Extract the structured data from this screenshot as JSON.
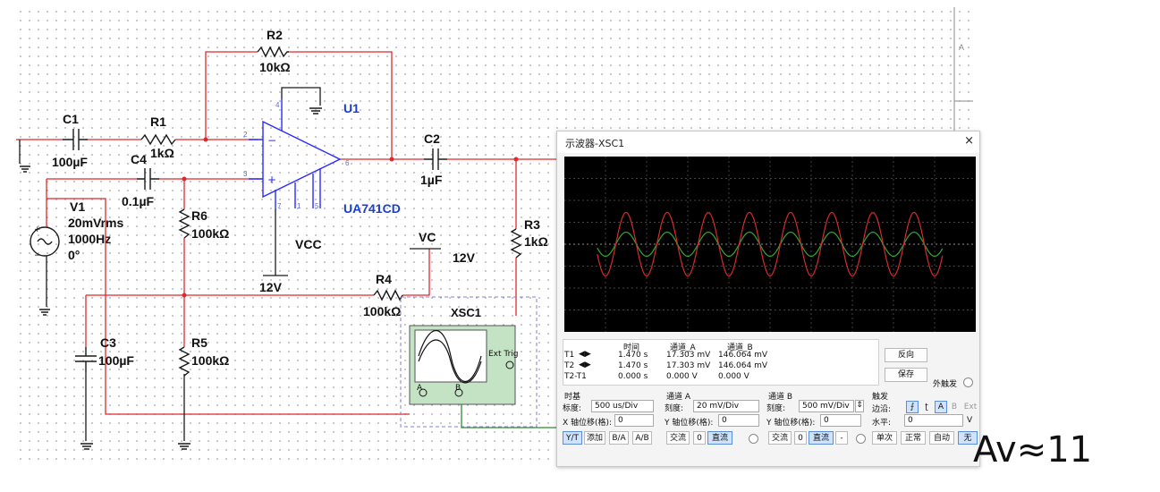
{
  "circuit": {
    "components": {
      "c1": {
        "name": "C1",
        "value": "100µF"
      },
      "r1": {
        "name": "R1",
        "value": "1kΩ"
      },
      "r2": {
        "name": "R2",
        "value": "10kΩ"
      },
      "c4": {
        "name": "C4",
        "value": "0.1µF"
      },
      "u1": {
        "name": "U1",
        "part": "UA741CD"
      },
      "c2": {
        "name": "C2",
        "value": "1µF"
      },
      "v1": {
        "name": "V1",
        "amp": "20mVrms",
        "freq": "1000Hz",
        "phase": "0°"
      },
      "r6": {
        "name": "R6",
        "value": "100kΩ"
      },
      "r3": {
        "name": "R3",
        "value": "1kΩ"
      },
      "r4": {
        "name": "R4",
        "value": "100kΩ"
      },
      "r5": {
        "name": "R5",
        "value": "100kΩ"
      },
      "c3": {
        "name": "C3",
        "value": "100µF"
      },
      "vcc": {
        "name": "VCC",
        "value": "12V"
      },
      "vc": {
        "name": "VC",
        "value": "12V"
      },
      "xsc1": {
        "name": "XSC1",
        "ext_trig": "Ext Trig",
        "ch_a": "A",
        "ch_b": "B"
      }
    },
    "pins": {
      "p2": "2",
      "p3": "3",
      "p4": "4",
      "p6": "6",
      "p7": "7",
      "p5": "5",
      "p1": "1"
    },
    "edge_label": "A"
  },
  "scope": {
    "title": "示波器-XSC1",
    "close": "×",
    "readout": {
      "headers": [
        "时间",
        "通道_A",
        "通道_B"
      ],
      "rows": [
        {
          "label": "T1",
          "time": "1.470 s",
          "a": "17.303 mV",
          "b": "146.064 mV"
        },
        {
          "label": "T2",
          "time": "1.470 s",
          "a": "17.303 mV",
          "b": "146.064 mV"
        },
        {
          "label": "T2-T1",
          "time": "0.000 s",
          "a": "0.000 V",
          "b": "0.000 V"
        }
      ],
      "reverse_btn": "反向",
      "save_btn": "保存",
      "ext_trigger": "外触发"
    },
    "timebase": {
      "title": "时基",
      "scale_label": "标度:",
      "scale": "500 us/Div",
      "xpos_label": "X 轴位移(格):",
      "xpos": "0",
      "modes": [
        "Y/T",
        "添加",
        "B/A",
        "A/B"
      ]
    },
    "channel_a": {
      "title": "通道 A",
      "scale_label": "刻度:",
      "scale": "20 mV/Div",
      "ypos_label": "Y 轴位移(格):",
      "ypos": "0",
      "coupling": [
        "交流",
        "0",
        "直流"
      ]
    },
    "channel_b": {
      "title": "通道 B",
      "scale_label": "刻度:",
      "scale": "500 mV/Div",
      "ypos_label": "Y 轴位移(格):",
      "ypos": "0",
      "coupling": [
        "交流",
        "0",
        "直流",
        "-"
      ]
    },
    "trigger": {
      "title": "触发",
      "edge_label": "边沿:",
      "channels": [
        "A",
        "B",
        "Ext"
      ],
      "level_label": "水平:",
      "level": "0",
      "level_unit": "V",
      "modes": [
        "单次",
        "正常",
        "自动",
        "无"
      ]
    },
    "traces": {
      "a_color": "#2fa82f",
      "b_color": "#d42b2b",
      "a_amplitude_div": 0.55,
      "b_amplitude_div": 1.45,
      "period_div": 1.0,
      "phase_div": 0.25
    }
  },
  "annotation": "Av≈11"
}
